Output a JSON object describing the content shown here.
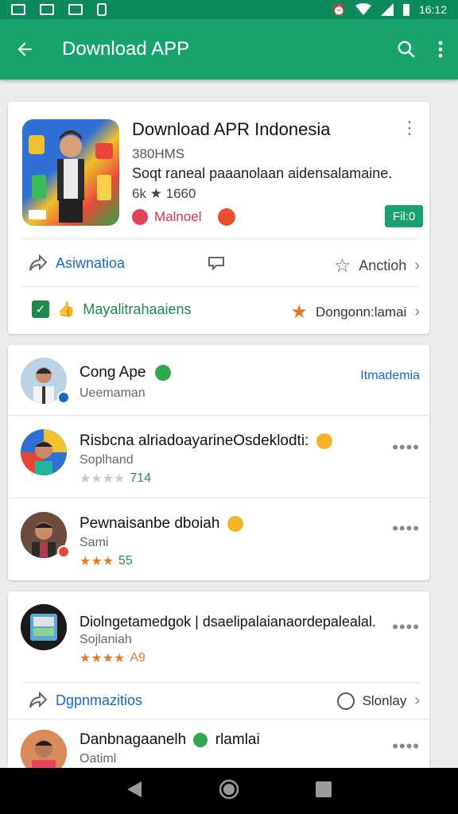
{
  "status_bar": {
    "time": "16:12"
  },
  "app_bar": {
    "title": "Download APP"
  },
  "app_card": {
    "title": "Download APR Indonesia",
    "size": "380HMS",
    "description": "Soqt raneal paaanolaan aidensalamaine.",
    "rating_line": "6k ★ 1660",
    "developer": "Malnoel",
    "install_label": "Fil:0",
    "share_label": "Asiwnatioa",
    "action_label": "Anctioh",
    "verified_label": "Mayalitrahaaiens",
    "star_label": "Dongonn:lamai"
  },
  "reviews_card": {
    "header": {
      "name": "Cong Ape",
      "sub": "Ueemaman",
      "action": "Itmademia"
    },
    "items": [
      {
        "name": "Risbcna alriadoayarineOsdeklodti:",
        "sub": "Soplhand",
        "rating_text": "714"
      },
      {
        "name": "Pewnaisanbe dboiah",
        "sub": "Sami",
        "rating_text": "55"
      }
    ]
  },
  "more_card": {
    "item": {
      "name": "Diolngetamedgok | dsaelipalaianaordepalealal.",
      "sub": "Sojlaniah",
      "rating_text": "A9"
    },
    "share_label": "Dgpnmazitios",
    "right_label": "Slonlay",
    "last": {
      "name": "Danbnagaanelh",
      "name_suffix": "rlamlai",
      "sub": "Oatiml"
    }
  },
  "colors": {
    "primary": "#17a36b",
    "status": "#0d8a5c",
    "star": "#e07b2a",
    "link": "#1a66c9"
  }
}
